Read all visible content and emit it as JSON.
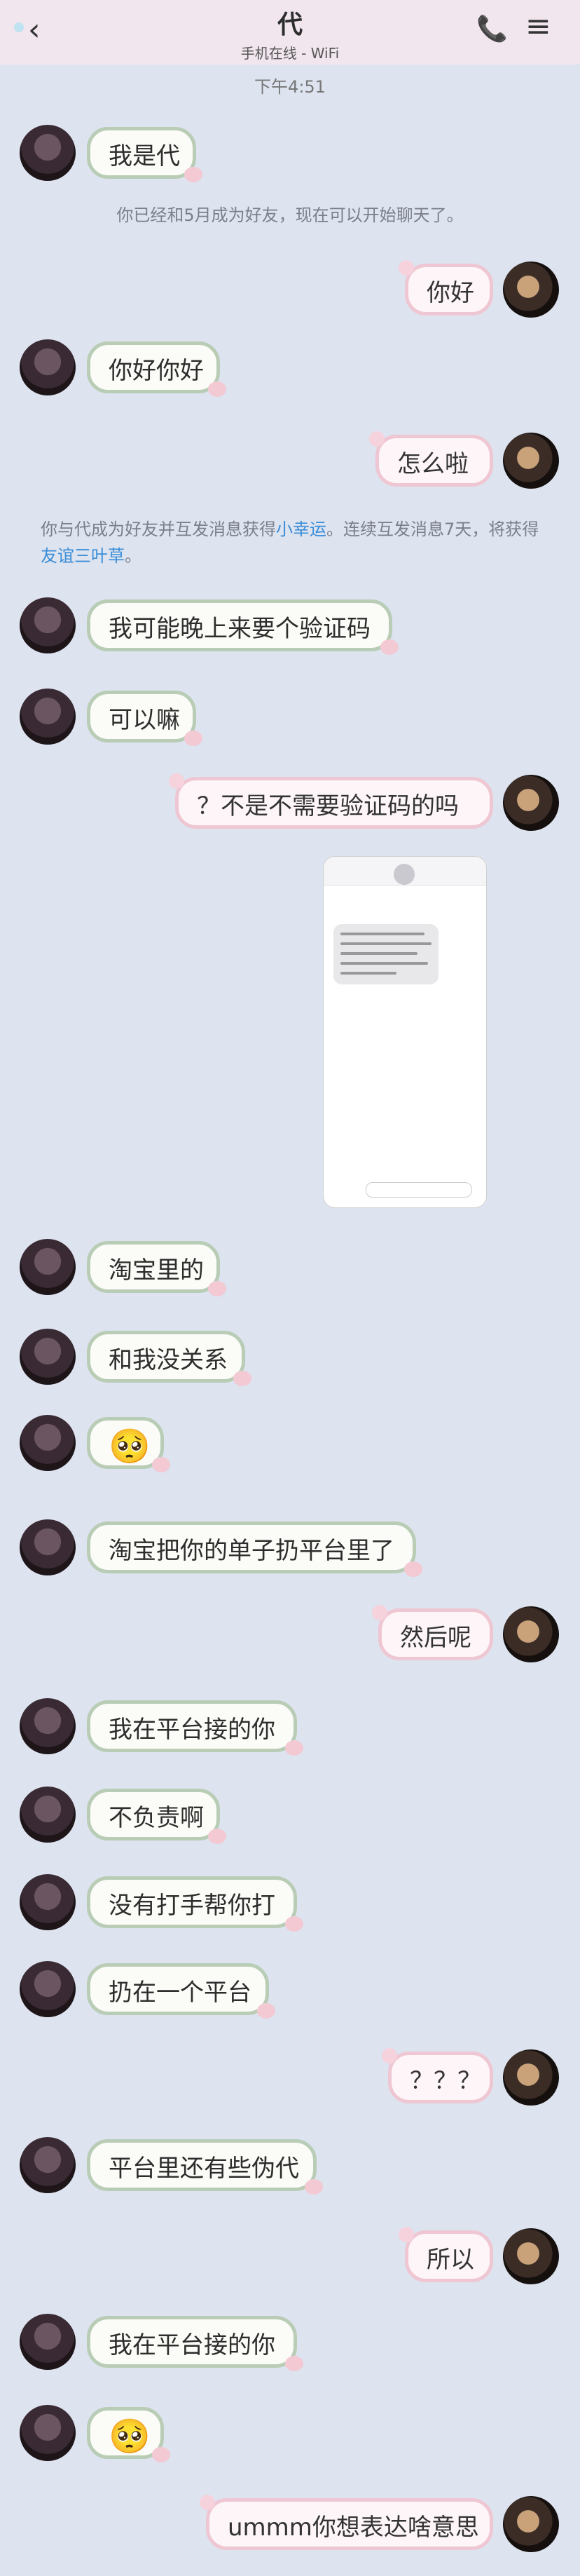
{
  "header": {
    "title": "代",
    "status": "手机在线 - WiFi",
    "back_icon": "chevron-left-icon",
    "phone_icon": "phone-icon",
    "menu_icon": "menu-icon"
  },
  "time": "下午4:51",
  "system": {
    "friend_notice": "你已经和5月成为好友，现在可以开始聊天了。",
    "lucky_part1": "你与代成为好友并互发消息获得",
    "lucky_link1": "小幸运",
    "lucky_part2": "。连续互发消息7天，将获得",
    "lucky_link2": "友谊三叶草",
    "lucky_part3": "。"
  },
  "messages": [
    {
      "side": "left",
      "text": "我是代"
    },
    {
      "side": "right",
      "text": "你好"
    },
    {
      "side": "left",
      "text": "你好你好"
    },
    {
      "side": "right",
      "text": "怎么啦"
    },
    {
      "side": "left",
      "text": "我可能晚上来要个验证码"
    },
    {
      "side": "left",
      "text": "可以嘛"
    },
    {
      "side": "right",
      "text": "？不是不需要验证码的吗"
    },
    {
      "side": "left",
      "text": "淘宝里的"
    },
    {
      "side": "left",
      "text": "和我没关系"
    },
    {
      "side": "left",
      "text": "🥺"
    },
    {
      "side": "left",
      "text": "淘宝把你的单子扔平台里了"
    },
    {
      "side": "right",
      "text": "然后呢"
    },
    {
      "side": "left",
      "text": "我在平台接的你"
    },
    {
      "side": "left",
      "text": "不负责啊"
    },
    {
      "side": "left",
      "text": "没有打手帮你打"
    },
    {
      "side": "left",
      "text": "扔在一个平台"
    },
    {
      "side": "right",
      "text": "？？？"
    },
    {
      "side": "left",
      "text": "平台里还有些伪代"
    },
    {
      "side": "right",
      "text": "所以"
    },
    {
      "side": "left",
      "text": "我在平台接的你"
    },
    {
      "side": "left",
      "text": "🥺"
    },
    {
      "side": "right",
      "text": "ummm你想表达啥意思"
    }
  ]
}
